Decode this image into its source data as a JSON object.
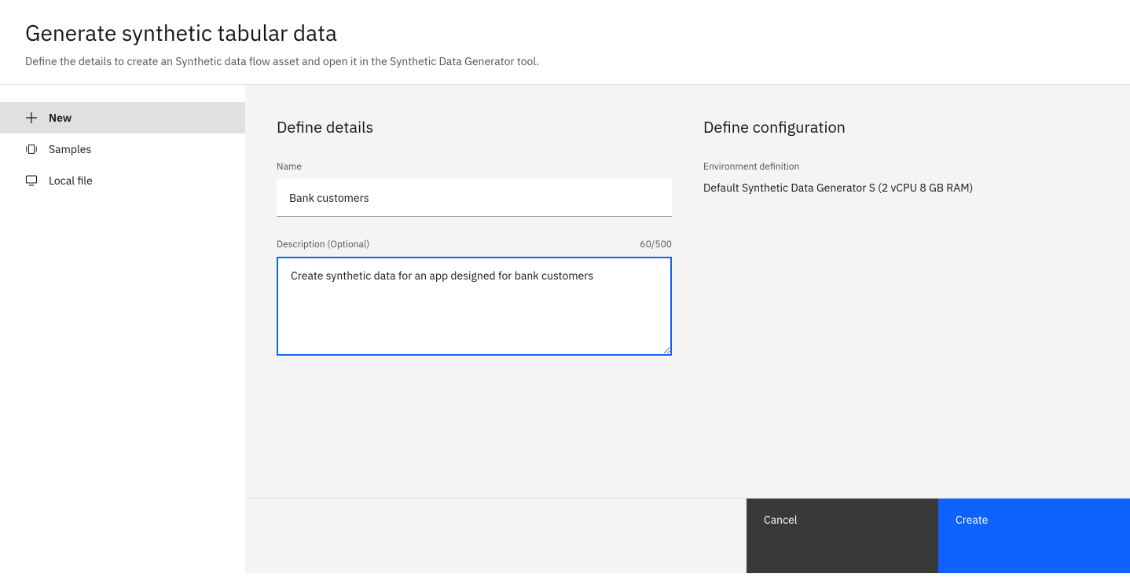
{
  "header": {
    "title": "Generate synthetic tabular data",
    "subtitle": "Define the details to create an Synthetic data flow asset and open it in the Synthetic Data Generator tool."
  },
  "sidebar": {
    "items": [
      {
        "label": "New",
        "icon": "plus-icon",
        "selected": true
      },
      {
        "label": "Samples",
        "icon": "carousel-icon",
        "selected": false
      },
      {
        "label": "Local file",
        "icon": "desktop-icon",
        "selected": false
      }
    ]
  },
  "details": {
    "heading": "Define details",
    "name_label": "Name",
    "name_value": "Bank customers",
    "description_label": "Description (Optional)",
    "description_value": "Create synthetic data for an app designed for bank customers",
    "char_count": "60/500"
  },
  "config": {
    "heading": "Define configuration",
    "env_label": "Environment definition",
    "env_value": "Default Synthetic Data Generator S (2 vCPU 8 GB RAM)"
  },
  "footer": {
    "cancel_label": "Cancel",
    "create_label": "Create"
  }
}
